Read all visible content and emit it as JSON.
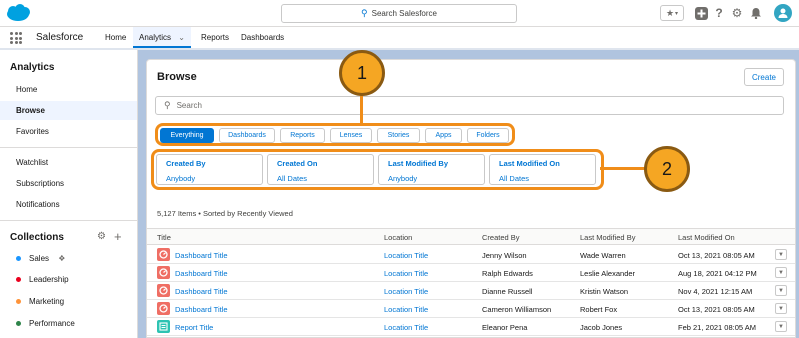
{
  "header": {
    "search_placeholder": "Search Salesforce",
    "favorites_icon": "star-icon",
    "add_icon": "plus-icon",
    "help_icon": "question-icon",
    "setup_icon": "gear-icon",
    "notifications_icon": "bell-icon",
    "avatar_icon": "user-icon"
  },
  "nav": {
    "app_name": "Salesforce",
    "items": [
      "Home",
      "Analytics",
      "Reports",
      "Dashboards"
    ],
    "active": "Analytics"
  },
  "sidebar": {
    "title": "Analytics",
    "items": [
      "Home",
      "Browse",
      "Favorites"
    ],
    "active": "Browse",
    "items2": [
      "Watchlist",
      "Subscriptions",
      "Notifications"
    ],
    "collections_title": "Collections",
    "collections": [
      {
        "label": "Sales",
        "color": "#1b96ff"
      },
      {
        "label": "Leadership",
        "color": "#ea001e"
      },
      {
        "label": "Marketing",
        "color": "#fe9339"
      },
      {
        "label": "Performance",
        "color": "#2e844a"
      }
    ]
  },
  "main": {
    "title": "Browse",
    "create_label": "Create",
    "search_placeholder": "Search",
    "tabs": [
      "Everything",
      "Dashboards",
      "Reports",
      "Lenses",
      "Stories",
      "Apps",
      "Folders"
    ],
    "active_tab": "Everything",
    "filters": [
      {
        "label": "Created By",
        "value": "Anybody"
      },
      {
        "label": "Created On",
        "value": "All Dates"
      },
      {
        "label": "Last Modified By",
        "value": "Anybody"
      },
      {
        "label": "Last Modified On",
        "value": "All Dates"
      }
    ],
    "count_text": "5,127 Items • Sorted by Recently Viewed",
    "columns": [
      "Title",
      "Location",
      "Created By",
      "Last Modified By",
      "Last Modified On"
    ],
    "rows": [
      {
        "type": "dashboard",
        "title": "Dashboard Title",
        "location": "Location Title",
        "created_by": "Jenny Wilson",
        "modified_by": "Wade Warren",
        "modified_on": "Oct 13, 2021 08:05 AM"
      },
      {
        "type": "dashboard",
        "title": "Dashboard Title",
        "location": "Location Title",
        "created_by": "Ralph Edwards",
        "modified_by": "Leslie Alexander",
        "modified_on": "Aug 18, 2021 04:12 PM"
      },
      {
        "type": "dashboard",
        "title": "Dashboard Title",
        "location": "Location Title",
        "created_by": "Dianne Russell",
        "modified_by": "Kristin Watson",
        "modified_on": "Nov 4, 2021 12:15 AM"
      },
      {
        "type": "dashboard",
        "title": "Dashboard Title",
        "location": "Location Title",
        "created_by": "Cameron Williamson",
        "modified_by": "Robert Fox",
        "modified_on": "Oct 13, 2021 08:05 AM"
      },
      {
        "type": "report",
        "title": "Report Title",
        "location": "Location Title",
        "created_by": "Eleanor Pena",
        "modified_by": "Jacob Jones",
        "modified_on": "Feb 21, 2021 08:05 AM"
      }
    ]
  },
  "callouts": [
    "1",
    "2"
  ],
  "colors": {
    "accent": "#0176d3",
    "callout_outline": "#f08d19",
    "callout_fill": "#f5a623",
    "dashboard_icon": "#ef6e64",
    "report_icon": "#2dc3b2"
  }
}
